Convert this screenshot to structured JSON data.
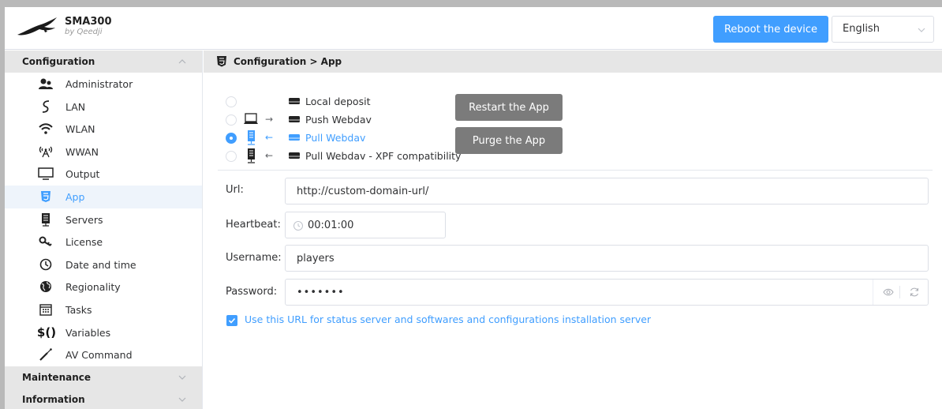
{
  "header": {
    "product_name": "SMA300",
    "product_sub": "by Qeedji",
    "reboot_label": "Reboot the device",
    "language": "English"
  },
  "sidebar": {
    "groups": [
      {
        "label": "Configuration",
        "expanded": true
      },
      {
        "label": "Maintenance",
        "expanded": false
      },
      {
        "label": "Information",
        "expanded": false
      }
    ],
    "items": [
      {
        "label": "Administrator",
        "icon": "administrator-icon"
      },
      {
        "label": "LAN",
        "icon": "lan-icon"
      },
      {
        "label": "WLAN",
        "icon": "wifi-icon"
      },
      {
        "label": "WWAN",
        "icon": "antenna-icon"
      },
      {
        "label": "Output",
        "icon": "monitor-icon"
      },
      {
        "label": "App",
        "icon": "html5-icon",
        "active": true
      },
      {
        "label": "Servers",
        "icon": "server-icon"
      },
      {
        "label": "License",
        "icon": "key-icon"
      },
      {
        "label": "Date and time",
        "icon": "clock-icon"
      },
      {
        "label": "Regionality",
        "icon": "globe-icon"
      },
      {
        "label": "Tasks",
        "icon": "calendar-icon"
      },
      {
        "label": "Variables",
        "icon": "variables-icon"
      },
      {
        "label": "AV Command",
        "icon": "av-command-icon"
      }
    ]
  },
  "main": {
    "breadcrumb": "Configuration > App",
    "sources": [
      {
        "label": "Local deposit",
        "checked": false,
        "arrow": ""
      },
      {
        "label": "Push Webdav",
        "checked": false,
        "arrow": "→"
      },
      {
        "label": "Pull Webdav",
        "checked": true,
        "arrow": "←"
      },
      {
        "label": "Pull Webdav - XPF compatibility",
        "checked": false,
        "arrow": "←"
      }
    ],
    "restart_label": "Restart the App",
    "purge_label": "Purge the App",
    "form": {
      "url_label": "Url:",
      "url_value": "http://custom-domain-url/",
      "heartbeat_label": "Heartbeat:",
      "heartbeat_value": "00:01:00",
      "username_label": "Username:",
      "username_value": "players",
      "password_label": "Password:",
      "password_value": "•••••••",
      "use_url_checked": true,
      "use_url_label": "Use this URL for status server and softwares and configurations installation server"
    }
  },
  "colors": {
    "accent": "#409eff",
    "gray_button": "#7b7b7b",
    "group_header_bg": "#e6e6e6"
  }
}
